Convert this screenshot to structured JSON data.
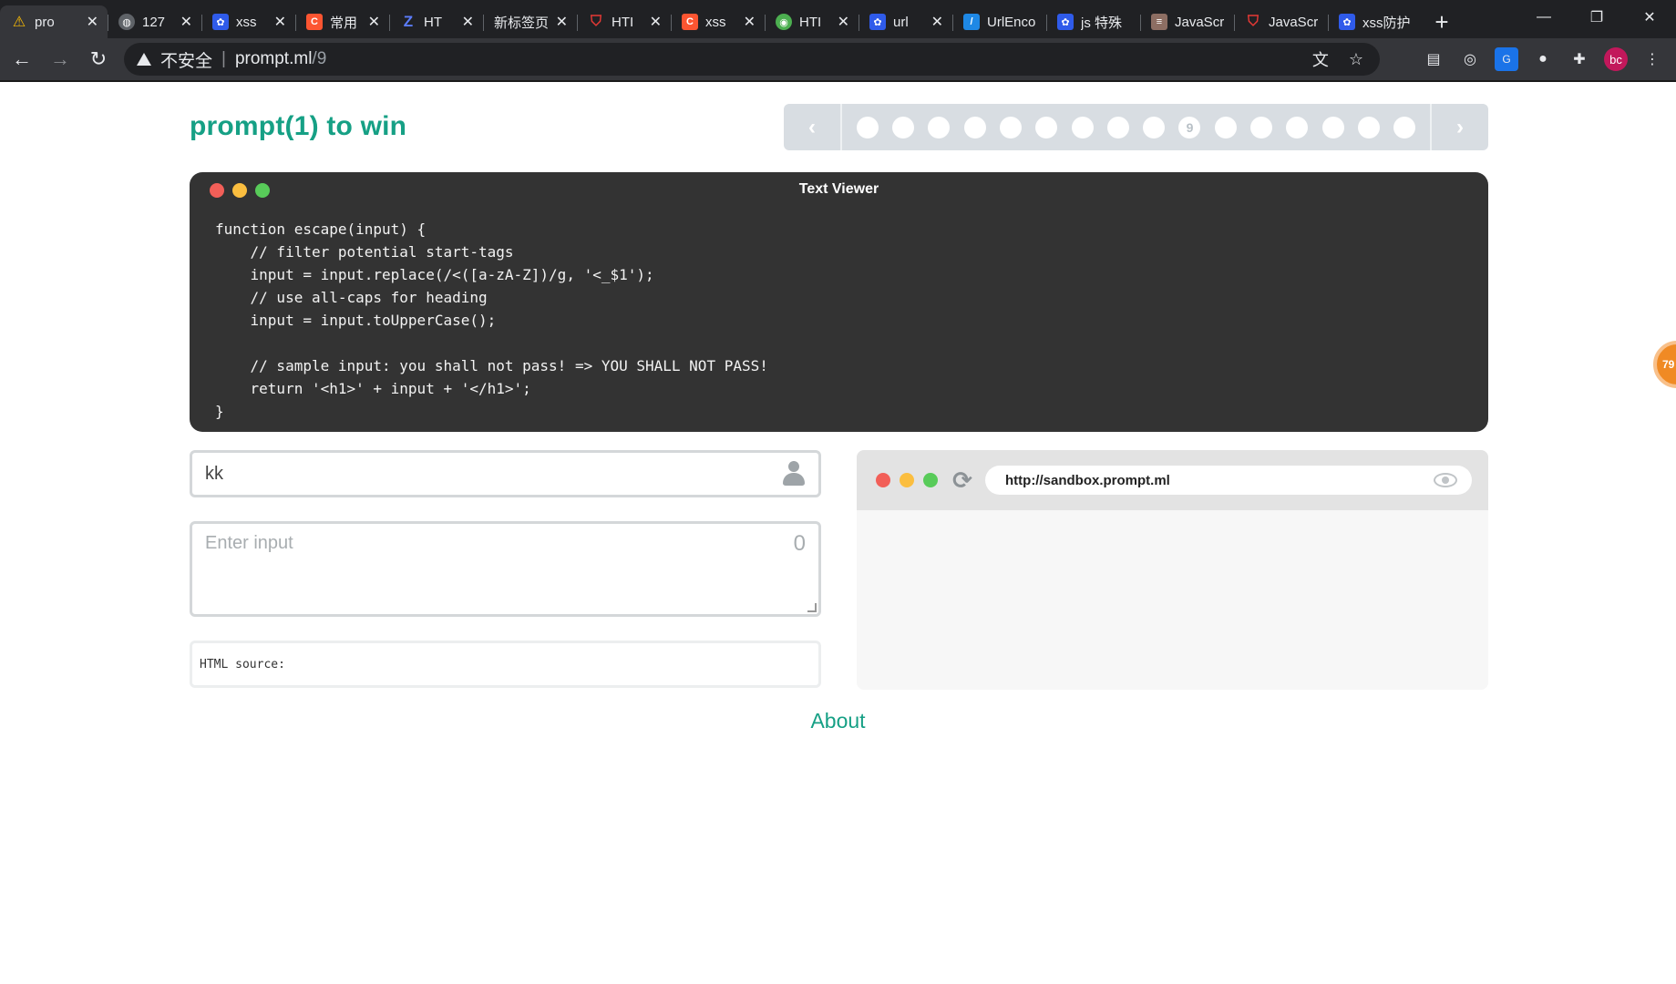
{
  "browser": {
    "tabs": [
      {
        "label": "pro",
        "favicon": "warning-icon",
        "color": "#fbbc04",
        "active": true
      },
      {
        "label": "127",
        "favicon": "globe-icon",
        "color": "#9aa0a6"
      },
      {
        "label": "xss",
        "favicon": "baidu-paw-icon",
        "color": "#2f5bea"
      },
      {
        "label": "常用",
        "favicon": "csdn-c-icon",
        "color": "#fc5531"
      },
      {
        "label": "HT",
        "favicon": "zhihu-z-icon",
        "color": "#3b5bdb"
      },
      {
        "label": "新标签页",
        "favicon": "",
        "color": ""
      },
      {
        "label": "HTI",
        "favicon": "shield-icon",
        "color": "#e53935"
      },
      {
        "label": "xss",
        "favicon": "csdn-c-icon",
        "color": "#fc5531"
      },
      {
        "label": "HTI",
        "favicon": "runoob-icon",
        "color": "#4caf50"
      },
      {
        "label": "url",
        "favicon": "baidu-paw-icon",
        "color": "#2f5bea"
      },
      {
        "label": "UrlEnco",
        "favicon": "tool-icon",
        "color": "#1e88e5"
      },
      {
        "label": "js 特殊",
        "favicon": "baidu-paw-icon",
        "color": "#2f5bea"
      },
      {
        "label": "JavaScr",
        "favicon": "book-icon",
        "color": "#8d6e63"
      },
      {
        "label": "JavaScr",
        "favicon": "shield-icon",
        "color": "#e53935"
      },
      {
        "label": "xss防护",
        "favicon": "baidu-paw-icon",
        "color": "#2f5bea"
      }
    ],
    "security_label": "不安全",
    "url_host": "prompt.ml",
    "url_path": "/9",
    "avatar_initials": "bc"
  },
  "page": {
    "title": "prompt(1) to win",
    "levels": [
      "",
      "",
      "",
      "",
      "",
      "",
      "",
      "",
      "",
      "9",
      "",
      "",
      "",
      "",
      "",
      ""
    ],
    "current_level_index": 9,
    "viewer_title": "Text Viewer",
    "code": "function escape(input) {\n    // filter potential start-tags\n    input = input.replace(/<([a-zA-Z])/g, '<_$1');\n    // use all-caps for heading\n    input = input.toUpperCase();\n\n    // sample input: you shall not pass! => YOU SHALL NOT PASS!\n    return '<h1>' + input + '</h1>';\n}",
    "username": "kk",
    "input_placeholder": "Enter input",
    "char_count": "0",
    "html_source_label": "HTML source:",
    "sandbox_url": "http://sandbox.prompt.ml",
    "about_label": "About",
    "side_badge": "79"
  },
  "colors": {
    "accent": "#16a085",
    "chrome_dark": "#202124",
    "chrome_toolbar": "#35363a"
  }
}
